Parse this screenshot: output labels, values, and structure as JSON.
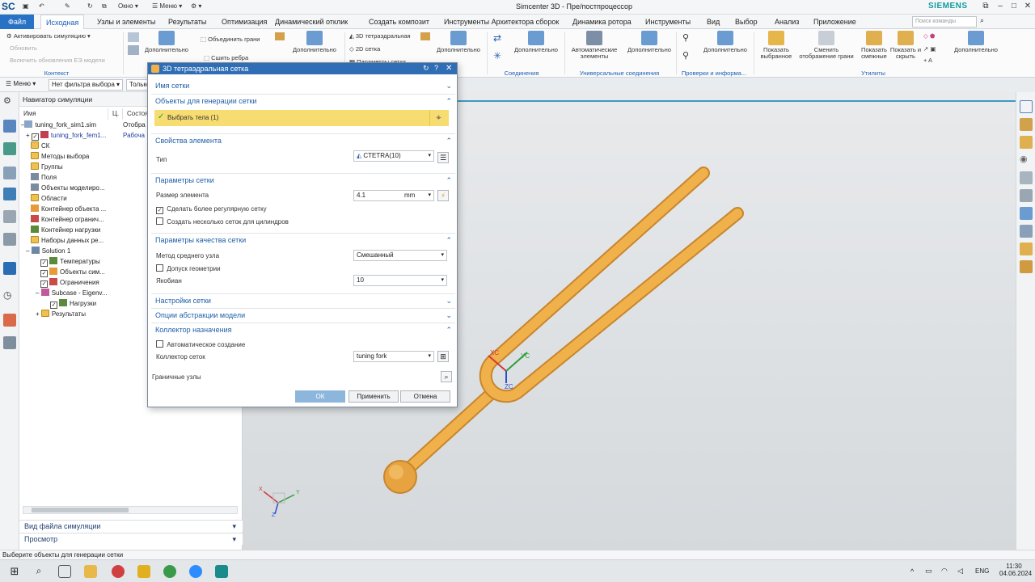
{
  "titlebar": {
    "logo": "SC",
    "window_menu": "Окно",
    "menu": "Меню",
    "title": "Simcenter 3D - Пре/постпроцессор",
    "brand": "SIEMENS"
  },
  "tabs": [
    "Файл",
    "Исходная",
    "Узлы и элементы",
    "Результаты",
    "Оптимизация",
    "Динамический отклик",
    "Создать композит",
    "Инструменты Архитектора сборок",
    "Динамика ротора",
    "Инструменты",
    "Вид",
    "Выбор",
    "Анализ",
    "Приложение"
  ],
  "search_placeholder": "Поиск команды",
  "ribbon": {
    "context": {
      "activate": "Активировать симуляцию",
      "update": "Обновить",
      "enable_updates": "Включить обновления ЕЭ модели",
      "group": "Контекст"
    },
    "merge_faces": "Объединить грани",
    "stitch_edges": "Сшить ребра",
    "more1": "Дополнительно",
    "more2": "Дополнительно",
    "tetra3d": "3D тетраэдральная",
    "mesh2d": "2D сетка",
    "mesh_params": "Параметры сетки",
    "more3": "Дополнительно",
    "more4": "Дополнительно",
    "connections_group": "Соединения",
    "auto_elements": "Автоматические элементы",
    "more5": "Дополнительно",
    "universal_group": "Универсальные соединения",
    "more6": "Дополнительно",
    "checks_group": "Проверки и информа...",
    "show_selected": "Показать выбранное",
    "change_face_display": "Сменить отображение грани",
    "show_adjacent": "Показать смежные",
    "show_hide": "Показать и скрыть",
    "more7": "Дополнительно",
    "utils_group": "Утилиты"
  },
  "filterbar": {
    "menu": "Меню",
    "filter": "Нет фильтра выбора",
    "scope": "Только"
  },
  "navigator": {
    "title": "Навигатор симуляции",
    "col_name": "Имя",
    "col_c": "Ц.",
    "col_state": "Состоя",
    "rows": [
      {
        "name": "tuning_fork_sim1.sim",
        "state": "Отобра"
      },
      {
        "name": "tuning_fork_fem1...",
        "state": "Рабоча"
      },
      {
        "name": "СК",
        "state": ""
      },
      {
        "name": "Методы выбора",
        "state": ""
      },
      {
        "name": "Группы",
        "state": ""
      },
      {
        "name": "Поля",
        "state": ""
      },
      {
        "name": "Объекты моделиро...",
        "state": ""
      },
      {
        "name": "Области",
        "state": ""
      },
      {
        "name": "Контейнер объекта ...",
        "state": ""
      },
      {
        "name": "Контейнер огранич...",
        "state": ""
      },
      {
        "name": "Контейнер нагрузки",
        "state": ""
      },
      {
        "name": "Наборы данных ре...",
        "state": ""
      },
      {
        "name": "Solution 1",
        "state": ""
      },
      {
        "name": "Температуры",
        "state": ""
      },
      {
        "name": "Объекты сим...",
        "state": ""
      },
      {
        "name": "Ограничения",
        "state": ""
      },
      {
        "name": "Subcase - Eigenv...",
        "state": ""
      },
      {
        "name": "Нагрузки",
        "state": ""
      },
      {
        "name": "Результаты",
        "state": ""
      }
    ],
    "footer1": "Вид файла симуляции",
    "footer2": "Просмотр"
  },
  "dialog": {
    "title": "3D тетраэдральная сетка",
    "sec_mesh_name": "Имя сетки",
    "sec_objects": "Объекты для генерации сетки",
    "select_bodies": "Выбрать тела (1)",
    "sec_element_props": "Свойства элемента",
    "type_label": "Тип",
    "type_value": "CTETRA(10)",
    "sec_mesh_params": "Параметры сетки",
    "element_size_label": "Размер элемента",
    "element_size_value": "4.1",
    "element_size_unit": "mm",
    "more_regular": "Сделать более регулярную сетку",
    "multi_cylinder": "Создать несколько сеток для цилиндров",
    "sec_quality": "Параметры качества сетки",
    "midnode_label": "Метод среднего узла",
    "midnode_value": "Смешанный",
    "geom_tolerance": "Допуск геометрии",
    "jacobian_label": "Якобиан",
    "jacobian_value": "10",
    "sec_mesh_settings": "Настройки сетки",
    "sec_abstraction": "Опции абстракции модели",
    "sec_collector": "Коллектор назначения",
    "auto_create": "Автоматическое создание",
    "collector_label": "Коллектор сеток",
    "collector_value": "tuning fork",
    "boundary_nodes": "Граничные узлы",
    "ok": "ОК",
    "apply": "Применить",
    "cancel": "Отмена"
  },
  "viewport": {
    "axis_xc": "XC",
    "axis_yc": "YC",
    "axis_zc": "ZC",
    "triad_x": "X",
    "triad_y": "Y",
    "triad_z": "Z"
  },
  "status_text": "Выберите объекты для генерации сетки",
  "taskbar": {
    "lang": "ENG",
    "time": "11:30",
    "date": "04.06.2024"
  },
  "colors": {
    "accent": "#2872c5",
    "highlight": "#f7dc72",
    "model": "#f0b04a"
  }
}
